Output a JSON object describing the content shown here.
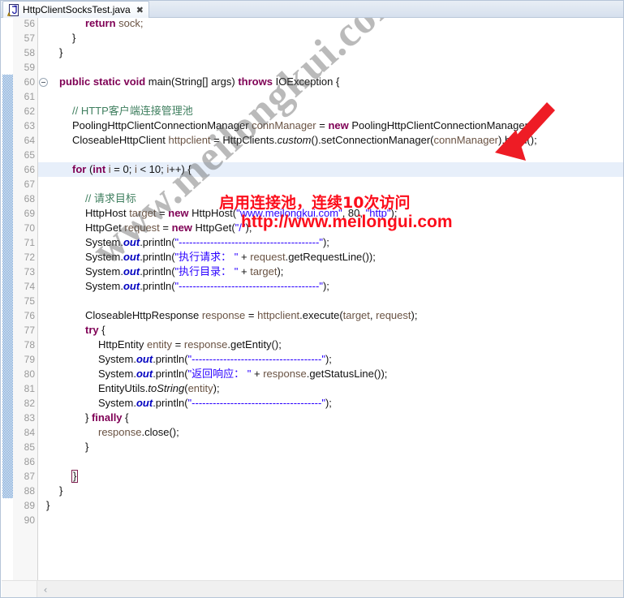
{
  "window": {
    "tab": {
      "label": "HttpClientSocksTest.java",
      "close_glyph": "✖",
      "icon": "java-file-warning-icon"
    }
  },
  "editor": {
    "first_visible_line": 56,
    "last_visible_line": 90,
    "highlighted_line": 66,
    "change_bar_from_line": 60,
    "change_bar_to_line": 88,
    "fold_marker_line": 60,
    "cursor_line": 87,
    "line_numbers": [
      56,
      57,
      58,
      59,
      60,
      61,
      62,
      63,
      64,
      65,
      66,
      67,
      68,
      69,
      70,
      71,
      72,
      73,
      74,
      75,
      76,
      77,
      78,
      79,
      80,
      81,
      82,
      83,
      84,
      85,
      86,
      87,
      88,
      89,
      90
    ],
    "lines": [
      {
        "n": 56,
        "indent": 3,
        "tokens": [
          {
            "t": "return ",
            "c": "kw"
          },
          {
            "t": "sock;",
            "c": "loc"
          }
        ]
      },
      {
        "n": 57,
        "indent": 2,
        "tokens": [
          {
            "t": "}",
            "c": "plain"
          }
        ]
      },
      {
        "n": 58,
        "indent": 1,
        "tokens": [
          {
            "t": "}",
            "c": "plain"
          }
        ]
      },
      {
        "n": 59,
        "indent": 0,
        "tokens": []
      },
      {
        "n": 60,
        "indent": 1,
        "tokens": [
          {
            "t": "public static void ",
            "c": "kw"
          },
          {
            "t": "main(String[] args) ",
            "c": "plain"
          },
          {
            "t": "throws ",
            "c": "kw"
          },
          {
            "t": "IOException {",
            "c": "plain"
          }
        ]
      },
      {
        "n": 61,
        "indent": 0,
        "tokens": []
      },
      {
        "n": 62,
        "indent": 2,
        "tokens": [
          {
            "t": "// HTTP客户端连接管理池",
            "c": "cmt"
          }
        ]
      },
      {
        "n": 63,
        "indent": 2,
        "tokens": [
          {
            "t": "PoolingHttpClientConnectionManager ",
            "c": "plain"
          },
          {
            "t": "connManager",
            "c": "loc"
          },
          {
            "t": " = ",
            "c": "plain"
          },
          {
            "t": "new ",
            "c": "kw"
          },
          {
            "t": "PoolingHttpClientConnectionManager();",
            "c": "plain"
          }
        ]
      },
      {
        "n": 64,
        "indent": 2,
        "tokens": [
          {
            "t": "CloseableHttpClient ",
            "c": "plain"
          },
          {
            "t": "httpclient",
            "c": "loc"
          },
          {
            "t": " = HttpClients.",
            "c": "plain"
          },
          {
            "t": "custom",
            "c": "stat"
          },
          {
            "t": "().setConnectionManager(",
            "c": "plain"
          },
          {
            "t": "connManager",
            "c": "loc"
          },
          {
            "t": ").build();",
            "c": "plain"
          }
        ]
      },
      {
        "n": 65,
        "indent": 0,
        "tokens": []
      },
      {
        "n": 66,
        "indent": 2,
        "tokens": [
          {
            "t": "for ",
            "c": "kw"
          },
          {
            "t": "(",
            "c": "plain"
          },
          {
            "t": "int ",
            "c": "kw"
          },
          {
            "t": "i",
            "c": "loc"
          },
          {
            "t": " = 0; ",
            "c": "plain"
          },
          {
            "t": "i",
            "c": "loc"
          },
          {
            "t": " < 10; ",
            "c": "plain"
          },
          {
            "t": "i",
            "c": "loc"
          },
          {
            "t": "++) {",
            "c": "plain"
          }
        ]
      },
      {
        "n": 67,
        "indent": 0,
        "tokens": []
      },
      {
        "n": 68,
        "indent": 3,
        "tokens": [
          {
            "t": "// 请求目标",
            "c": "cmt"
          }
        ]
      },
      {
        "n": 69,
        "indent": 3,
        "tokens": [
          {
            "t": "HttpHost ",
            "c": "plain"
          },
          {
            "t": "target",
            "c": "loc"
          },
          {
            "t": " = ",
            "c": "plain"
          },
          {
            "t": "new ",
            "c": "kw"
          },
          {
            "t": "HttpHost(",
            "c": "plain"
          },
          {
            "t": "\"www.meilongkui.com\"",
            "c": "str"
          },
          {
            "t": ", 80, ",
            "c": "plain"
          },
          {
            "t": "\"http\"",
            "c": "str"
          },
          {
            "t": ");",
            "c": "plain"
          }
        ]
      },
      {
        "n": 70,
        "indent": 3,
        "tokens": [
          {
            "t": "HttpGet ",
            "c": "plain"
          },
          {
            "t": "request",
            "c": "loc"
          },
          {
            "t": " = ",
            "c": "plain"
          },
          {
            "t": "new ",
            "c": "kw"
          },
          {
            "t": "HttpGet(",
            "c": "plain"
          },
          {
            "t": "\"/\"",
            "c": "str"
          },
          {
            "t": ");",
            "c": "plain"
          }
        ]
      },
      {
        "n": 71,
        "indent": 3,
        "tokens": [
          {
            "t": "System.",
            "c": "plain"
          },
          {
            "t": "out",
            "c": "fld"
          },
          {
            "t": ".println(",
            "c": "plain"
          },
          {
            "t": "\"----------------------------------------\"",
            "c": "str"
          },
          {
            "t": ");",
            "c": "plain"
          }
        ]
      },
      {
        "n": 72,
        "indent": 3,
        "tokens": [
          {
            "t": "System.",
            "c": "plain"
          },
          {
            "t": "out",
            "c": "fld"
          },
          {
            "t": ".println(",
            "c": "plain"
          },
          {
            "t": "\"执行请求： \"",
            "c": "str"
          },
          {
            "t": " + ",
            "c": "plain"
          },
          {
            "t": "request",
            "c": "loc"
          },
          {
            "t": ".getRequestLine());",
            "c": "plain"
          }
        ]
      },
      {
        "n": 73,
        "indent": 3,
        "tokens": [
          {
            "t": "System.",
            "c": "plain"
          },
          {
            "t": "out",
            "c": "fld"
          },
          {
            "t": ".println(",
            "c": "plain"
          },
          {
            "t": "\"执行目录： \"",
            "c": "str"
          },
          {
            "t": " + ",
            "c": "plain"
          },
          {
            "t": "target",
            "c": "loc"
          },
          {
            "t": ");",
            "c": "plain"
          }
        ]
      },
      {
        "n": 74,
        "indent": 3,
        "tokens": [
          {
            "t": "System.",
            "c": "plain"
          },
          {
            "t": "out",
            "c": "fld"
          },
          {
            "t": ".println(",
            "c": "plain"
          },
          {
            "t": "\"----------------------------------------\"",
            "c": "str"
          },
          {
            "t": ");",
            "c": "plain"
          }
        ]
      },
      {
        "n": 75,
        "indent": 0,
        "tokens": []
      },
      {
        "n": 76,
        "indent": 3,
        "tokens": [
          {
            "t": "CloseableHttpResponse ",
            "c": "plain"
          },
          {
            "t": "response",
            "c": "loc"
          },
          {
            "t": " = ",
            "c": "plain"
          },
          {
            "t": "httpclient",
            "c": "loc"
          },
          {
            "t": ".execute(",
            "c": "plain"
          },
          {
            "t": "target",
            "c": "loc"
          },
          {
            "t": ", ",
            "c": "plain"
          },
          {
            "t": "request",
            "c": "loc"
          },
          {
            "t": ");",
            "c": "plain"
          }
        ]
      },
      {
        "n": 77,
        "indent": 3,
        "tokens": [
          {
            "t": "try ",
            "c": "kw"
          },
          {
            "t": "{",
            "c": "plain"
          }
        ]
      },
      {
        "n": 78,
        "indent": 4,
        "tokens": [
          {
            "t": "HttpEntity ",
            "c": "plain"
          },
          {
            "t": "entity",
            "c": "loc"
          },
          {
            "t": " = ",
            "c": "plain"
          },
          {
            "t": "response",
            "c": "loc"
          },
          {
            "t": ".getEntity();",
            "c": "plain"
          }
        ]
      },
      {
        "n": 79,
        "indent": 4,
        "tokens": [
          {
            "t": "System.",
            "c": "plain"
          },
          {
            "t": "out",
            "c": "fld"
          },
          {
            "t": ".println(",
            "c": "plain"
          },
          {
            "t": "\"-------------------------------------\"",
            "c": "str"
          },
          {
            "t": ");",
            "c": "plain"
          }
        ]
      },
      {
        "n": 80,
        "indent": 4,
        "tokens": [
          {
            "t": "System.",
            "c": "plain"
          },
          {
            "t": "out",
            "c": "fld"
          },
          {
            "t": ".println(",
            "c": "plain"
          },
          {
            "t": "\"返回响应： \"",
            "c": "str"
          },
          {
            "t": " + ",
            "c": "plain"
          },
          {
            "t": "response",
            "c": "loc"
          },
          {
            "t": ".getStatusLine());",
            "c": "plain"
          }
        ]
      },
      {
        "n": 81,
        "indent": 4,
        "tokens": [
          {
            "t": "EntityUtils.",
            "c": "plain"
          },
          {
            "t": "toString",
            "c": "stat"
          },
          {
            "t": "(",
            "c": "plain"
          },
          {
            "t": "entity",
            "c": "loc"
          },
          {
            "t": ");",
            "c": "plain"
          }
        ]
      },
      {
        "n": 82,
        "indent": 4,
        "tokens": [
          {
            "t": "System.",
            "c": "plain"
          },
          {
            "t": "out",
            "c": "fld"
          },
          {
            "t": ".println(",
            "c": "plain"
          },
          {
            "t": "\"-------------------------------------\"",
            "c": "str"
          },
          {
            "t": ");",
            "c": "plain"
          }
        ]
      },
      {
        "n": 83,
        "indent": 3,
        "tokens": [
          {
            "t": "} ",
            "c": "plain"
          },
          {
            "t": "finally ",
            "c": "kw"
          },
          {
            "t": "{",
            "c": "plain"
          }
        ]
      },
      {
        "n": 84,
        "indent": 4,
        "tokens": [
          {
            "t": "response",
            "c": "loc"
          },
          {
            "t": ".close();",
            "c": "plain"
          }
        ]
      },
      {
        "n": 85,
        "indent": 3,
        "tokens": [
          {
            "t": "}",
            "c": "plain"
          }
        ]
      },
      {
        "n": 86,
        "indent": 0,
        "tokens": []
      },
      {
        "n": 87,
        "indent": 2,
        "tokens": [
          {
            "t": "}",
            "c": "cursorbox"
          }
        ]
      },
      {
        "n": 88,
        "indent": 1,
        "tokens": [
          {
            "t": "}",
            "c": "plain"
          }
        ]
      },
      {
        "n": 89,
        "indent": 0,
        "tokens": [
          {
            "t": "}",
            "c": "plain"
          }
        ]
      },
      {
        "n": 90,
        "indent": 0,
        "tokens": []
      }
    ]
  },
  "annotations": {
    "red_note_line1": "启用连接池，连续10次访问",
    "red_note_line2": "http://www.meilongui.com",
    "red_color": "#fc0d1b",
    "arrow": "red-down-left-arrow"
  },
  "watermark": {
    "text": "www.meilongkui.com",
    "color": "#5a5a5a"
  },
  "scrollbar": {
    "left_arrow_glyph": "‹"
  },
  "colors": {
    "keyword": "#7f0055",
    "string": "#2a00ff",
    "comment": "#3f7f5f",
    "field": "#0000c0",
    "local_var": "#6a5343",
    "line_number": "#9a9a9a",
    "highlight_row": "#e7effa",
    "change_bar": "#4a86c8"
  }
}
